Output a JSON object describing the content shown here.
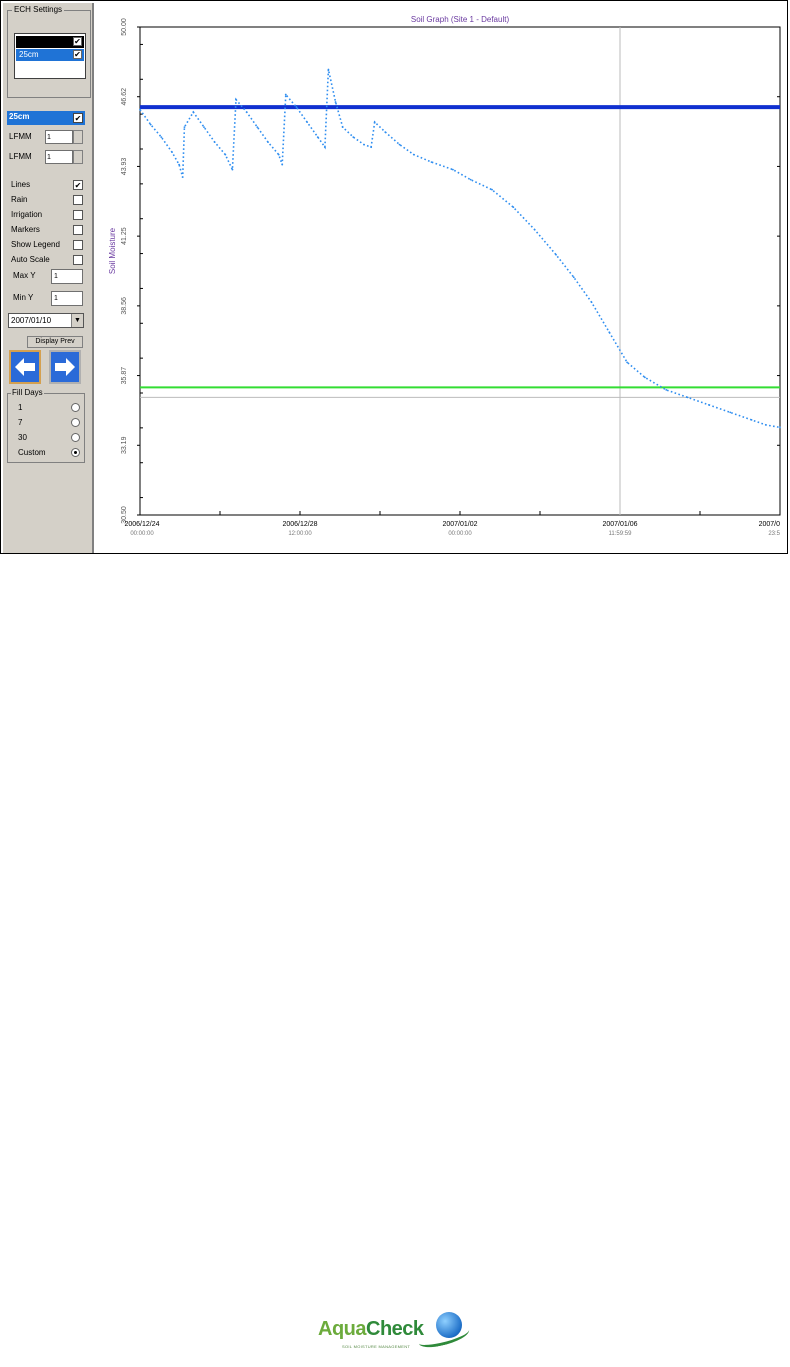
{
  "panel": {
    "ech_group_label": "ECH Settings",
    "ech_items": [
      {
        "label": "",
        "checked": "✔",
        "bg": "#000000"
      },
      {
        "label": "25cm",
        "checked": "✔",
        "bg": "#1f73d6"
      }
    ],
    "selected_sensor": {
      "label": "25cm",
      "checked": "✔"
    },
    "lfmm_fields": [
      {
        "label": "LFMM",
        "value": "1"
      },
      {
        "label": "LFMM",
        "value": "1"
      }
    ],
    "options": [
      {
        "label": "Lines",
        "checked": "✔"
      },
      {
        "label": "Rain",
        "checked": ""
      },
      {
        "label": "Irrigation",
        "checked": ""
      },
      {
        "label": "Markers",
        "checked": ""
      },
      {
        "label": "Show Legend",
        "checked": ""
      },
      {
        "label": "Auto Scale",
        "checked": ""
      }
    ],
    "max_y": {
      "label": "Max Y",
      "value": "1"
    },
    "min_y": {
      "label": "Min Y",
      "value": "1"
    },
    "date_select": "2007/01/10",
    "dd_glyph": "▼",
    "tool_label": "Display Prev",
    "days_group_label": "Fill Days",
    "days_options": [
      {
        "label": "1",
        "selected": false
      },
      {
        "label": "7",
        "selected": false
      },
      {
        "label": "30",
        "selected": false
      },
      {
        "label": "Custom",
        "selected": true
      }
    ]
  },
  "chart_data": {
    "type": "line",
    "title": "Soil Graph (Site 1 - Default)",
    "ylabel": "Soil Moisture",
    "x_ticks": [
      {
        "date": "2006/12/24",
        "time": "00:00:00"
      },
      {
        "date": "2006/12/28",
        "time": "12:00:00"
      },
      {
        "date": "2007/01/02",
        "time": "00:00:00"
      },
      {
        "date": "2007/01/06",
        "time": "11:59:59"
      },
      {
        "date": "2007/0",
        "time": "23:5"
      }
    ],
    "y_ticks": [
      "50.00",
      "46.62",
      "43.93",
      "41.25",
      "38.56",
      "35.87",
      "33.19",
      "30.50"
    ],
    "ylim": [
      30.5,
      50.0
    ],
    "xlim": [
      0,
      18
    ],
    "reference_lines": [
      {
        "name": "upper",
        "value": 46.8,
        "color": "#1030d0"
      },
      {
        "name": "lower",
        "value": 35.6,
        "color": "#33dd33"
      }
    ],
    "gray_h_line": 35.2,
    "gray_v_line_x": 13.5,
    "series": [
      {
        "color": "#2f8ef0",
        "points": [
          [
            0.0,
            46.7
          ],
          [
            0.3,
            46.1
          ],
          [
            0.6,
            45.6
          ],
          [
            0.9,
            45.0
          ],
          [
            1.1,
            44.5
          ],
          [
            1.2,
            44.0
          ],
          [
            1.25,
            46.0
          ],
          [
            1.5,
            46.6
          ],
          [
            1.8,
            46.0
          ],
          [
            2.1,
            45.4
          ],
          [
            2.4,
            44.9
          ],
          [
            2.6,
            44.3
          ],
          [
            2.7,
            47.1
          ],
          [
            3.0,
            46.6
          ],
          [
            3.3,
            46.0
          ],
          [
            3.6,
            45.4
          ],
          [
            3.9,
            44.9
          ],
          [
            4.0,
            44.5
          ],
          [
            4.1,
            47.3
          ],
          [
            4.4,
            46.8
          ],
          [
            4.7,
            46.2
          ],
          [
            5.0,
            45.6
          ],
          [
            5.2,
            45.2
          ],
          [
            5.3,
            48.3
          ],
          [
            5.5,
            47.0
          ],
          [
            5.7,
            46.0
          ],
          [
            6.0,
            45.6
          ],
          [
            6.3,
            45.3
          ],
          [
            6.5,
            45.2
          ],
          [
            6.6,
            46.2
          ],
          [
            6.9,
            45.8
          ],
          [
            7.3,
            45.3
          ],
          [
            7.7,
            44.9
          ],
          [
            8.2,
            44.6
          ],
          [
            8.8,
            44.3
          ],
          [
            9.3,
            43.9
          ],
          [
            9.9,
            43.5
          ],
          [
            10.5,
            42.8
          ],
          [
            11.1,
            41.9
          ],
          [
            11.7,
            40.9
          ],
          [
            12.2,
            40.0
          ],
          [
            12.7,
            39.0
          ],
          [
            13.2,
            37.8
          ],
          [
            13.7,
            36.6
          ],
          [
            14.2,
            36.0
          ],
          [
            14.8,
            35.5
          ],
          [
            15.4,
            35.2
          ],
          [
            16.0,
            34.9
          ],
          [
            16.6,
            34.6
          ],
          [
            17.2,
            34.3
          ],
          [
            17.6,
            34.1
          ],
          [
            18.0,
            34.0
          ]
        ]
      }
    ]
  }
}
